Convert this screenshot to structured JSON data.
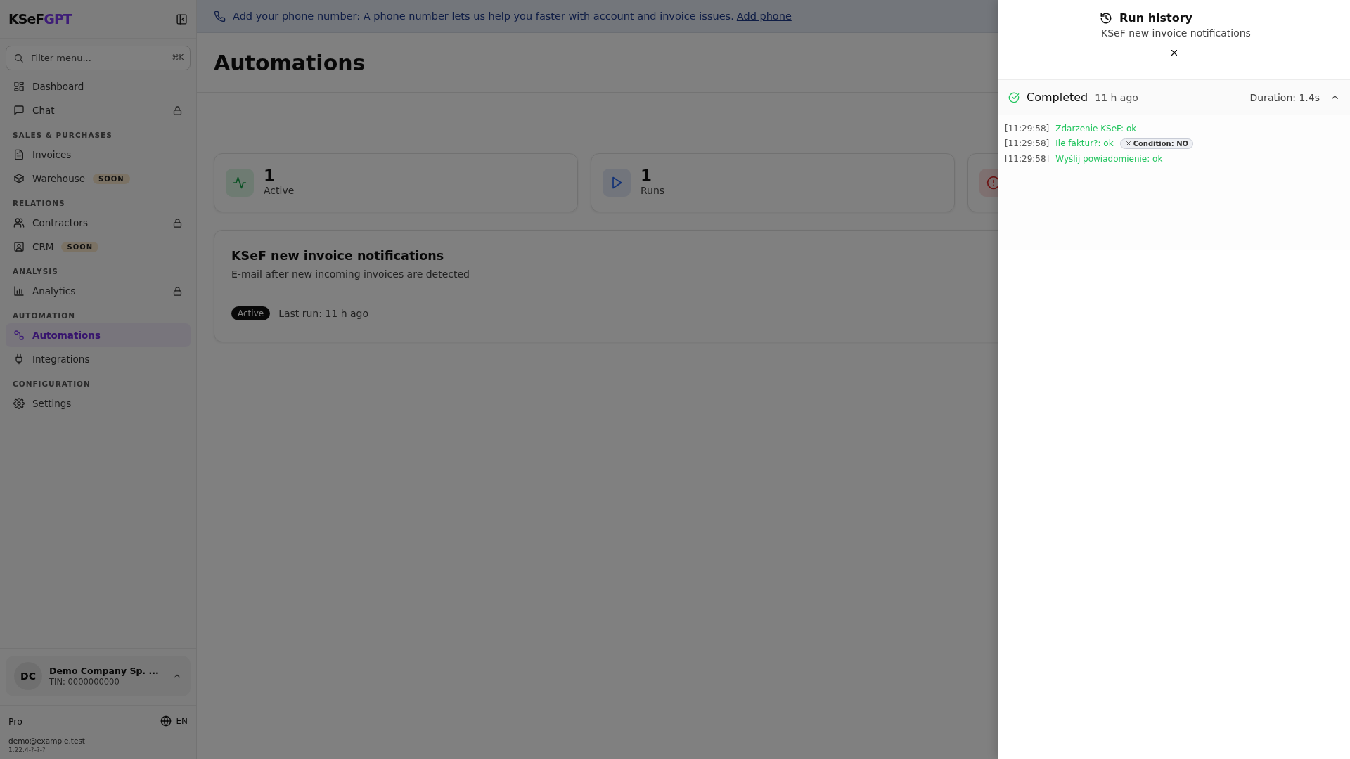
{
  "sidebar": {
    "logo": {
      "part_1": "KSeF",
      "part_2": "GPT"
    },
    "search": {
      "placeholder": "Filter menu...",
      "shortcut": "⌘K"
    },
    "groups": [
      {
        "items": [
          {
            "label": "Dashboard",
            "selected": false,
            "locked": false
          },
          {
            "label": "Chat",
            "selected": false,
            "locked": true
          }
        ]
      },
      {
        "title": "SALES & PURCHASES",
        "items": [
          {
            "label": "Invoices",
            "selected": false,
            "locked": false
          },
          {
            "label": "Warehouse",
            "selected": false,
            "locked": false,
            "badge": "SOON"
          }
        ]
      },
      {
        "title": "RELATIONS",
        "items": [
          {
            "label": "Contractors",
            "selected": false,
            "locked": true
          },
          {
            "label": "CRM",
            "selected": false,
            "locked": false,
            "badge": "SOON"
          }
        ]
      },
      {
        "title": "ANALYSIS",
        "items": [
          {
            "label": "Analytics",
            "selected": false,
            "locked": true
          }
        ]
      },
      {
        "title": "AUTOMATION",
        "items": [
          {
            "label": "Automations",
            "selected": true,
            "locked": false
          },
          {
            "label": "Integrations",
            "selected": false,
            "locked": false
          }
        ]
      },
      {
        "title": "CONFIGURATION",
        "items": [
          {
            "label": "Settings",
            "selected": false,
            "locked": false
          }
        ]
      }
    ],
    "account": {
      "initials": "DC",
      "name": "Demo Company Sp. ...",
      "tin": "TIN: 0000000000"
    },
    "plan": "Pro",
    "language": "EN",
    "email": "demo@example.test",
    "version": "1.22.4-?-?-?"
  },
  "banner": {
    "text": "Add your phone number: A phone number lets us help you faster with account and invoice issues.",
    "link": "Add phone"
  },
  "page": {
    "title": "Automations",
    "stats": [
      {
        "kind": "active",
        "value": "1",
        "label": "Active"
      },
      {
        "kind": "runs",
        "value": "1",
        "label": "Runs"
      },
      {
        "kind": "errors"
      }
    ],
    "automations": [
      {
        "title": "KSeF new invoice notifications",
        "description": "E-mail after new incoming invoices are detected",
        "status": "Active",
        "last_run": "Last run: 11 h ago"
      }
    ]
  },
  "run_history": {
    "title": "Run history",
    "subtitle": "KSeF new invoice notifications",
    "runs": [
      {
        "kind": "completed",
        "status": "Completed",
        "time": "11 h ago",
        "duration": "Duration: 1.4s",
        "expanded": true,
        "log": [
          {
            "time": "[11:29:58]",
            "text": "Zdarzenie KSeF: ok"
          },
          {
            "time": "[11:29:58]",
            "text": "Ile faktur?: ok",
            "badge": "Condition: NO"
          },
          {
            "time": "[11:29:58]",
            "text": "Wyślij powiadomienie: ok"
          }
        ]
      }
    ]
  }
}
